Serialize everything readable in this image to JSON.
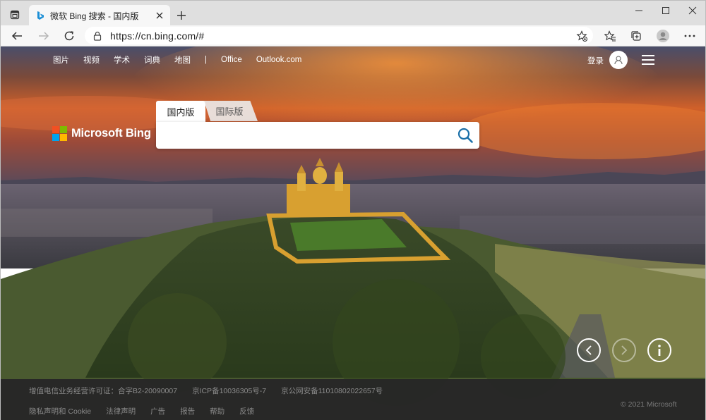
{
  "browser": {
    "tab_title": "微软 Bing 搜索 - 国内版",
    "url": "https://cn.bing.com/#"
  },
  "bing": {
    "nav": {
      "images": "图片",
      "videos": "视频",
      "academic": "学术",
      "dictionary": "词典",
      "maps": "地图",
      "separator": "|",
      "office": "Office",
      "outlook": "Outlook.com"
    },
    "login": "登录",
    "logo_text": "Microsoft Bing",
    "search_tabs": {
      "domestic": "国内版",
      "international": "国际版"
    },
    "search_value": ""
  },
  "footer": {
    "row1": [
      "增值电信业务经营许可证：合字B2-20090007",
      "京ICP备10036305号-7",
      "京公网安备11010802022657号"
    ],
    "row2": [
      "隐私声明和 Cookie",
      "法律声明",
      "广告",
      "报告",
      "帮助",
      "反馈"
    ],
    "copyright": "© 2021 Microsoft"
  },
  "colors": {
    "accent": "#1a6fa8",
    "tabstrip": "#dfdfdf",
    "toolbar": "#f7f7f7",
    "footer_bg": "#262626"
  },
  "icons": [
    "tab-actions-icon",
    "bing-favicon-icon",
    "close-icon",
    "plus-icon",
    "minimize-icon",
    "maximize-icon",
    "close-window-icon",
    "back-icon",
    "forward-icon",
    "refresh-icon",
    "lock-icon",
    "add-favorite-icon",
    "favorites-icon",
    "collections-icon",
    "profile-icon",
    "more-icon",
    "user-avatar-icon",
    "hamburger-menu-icon",
    "search-icon",
    "previous-image-icon",
    "next-image-icon",
    "info-icon"
  ]
}
